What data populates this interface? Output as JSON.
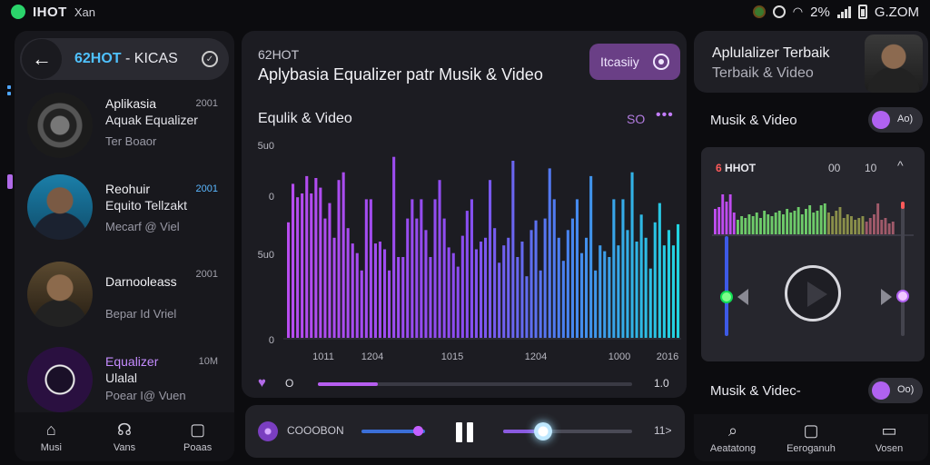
{
  "statusbar": {
    "app": "IHOT",
    "app_small": "Xan",
    "battery_pct": "2%",
    "time": "G.ZOM"
  },
  "left": {
    "header_accent": "62HOT",
    "header_title": " - KICAS",
    "items": [
      {
        "t1": "Aplikasia",
        "t2": "Aquak Equalizer",
        "t3": "Ter Boaor",
        "num": "2001"
      },
      {
        "t1": "Reohuir",
        "t2": "Equito Tellzakt",
        "t3": "Mecarf @ Viel",
        "num": "2001"
      },
      {
        "t1": "Darnooleass",
        "t2": "",
        "t3": "Bepar Id Vriel",
        "num": "2001"
      },
      {
        "t1": "Equalizer",
        "t2": "Ulalal",
        "t3": "Poear I@ Vuen",
        "num": "10M"
      }
    ],
    "nav": [
      {
        "icon": "⌂",
        "label": "Musi"
      },
      {
        "icon": "☊",
        "label": "Vans"
      },
      {
        "icon": "▢",
        "label": "Poaas"
      }
    ]
  },
  "center": {
    "small": "62HOT",
    "title": "Aplybasia Equalizer patr Musik & Video",
    "button_label": "Itcasiiy",
    "sub": "Equlik & Video",
    "count": "SO",
    "more": "•••",
    "progress_left": "O",
    "progress_right": "1.0",
    "progress": 0.19
  },
  "chart_data": {
    "type": "bar",
    "y_tick_labels": [
      "5u0",
      "0",
      "5u0",
      "0"
    ],
    "x_tick_labels": [
      "1011",
      "1204",
      "1015",
      "1204",
      "1000",
      "2016"
    ],
    "colors": [
      "#b84cf0",
      "#8a4cf0",
      "#4a7ff0",
      "#21d6df"
    ],
    "values": [
      60,
      80,
      73,
      75,
      84,
      75,
      83,
      78,
      62,
      70,
      52,
      82,
      86,
      57,
      49,
      44,
      35,
      72,
      72,
      49,
      50,
      46,
      35,
      94,
      42,
      42,
      62,
      72,
      62,
      72,
      56,
      42,
      72,
      82,
      62,
      47,
      44,
      37,
      53,
      66,
      72,
      46,
      50,
      52,
      82,
      57,
      39,
      48,
      52,
      92,
      42,
      50,
      32,
      56,
      61,
      35,
      62,
      88,
      72,
      52,
      40,
      56,
      62,
      72,
      44,
      52,
      84,
      35,
      48,
      45,
      42,
      72,
      48,
      72,
      56,
      86,
      50,
      64,
      52,
      36,
      60,
      70,
      48,
      56,
      48,
      59
    ]
  },
  "player": {
    "label": "COOOBON",
    "time": "11>",
    "volume": 0.85,
    "position": 0.31
  },
  "right": {
    "top_t1": "Aplulalizer Terbaik",
    "top_t2": "Terbaik & Video",
    "row1_label": "Musik & Video",
    "row1_toggle": "Ao)",
    "eq_title_red": "6",
    "eq_title": " HHOT",
    "eq_a": "00",
    "eq_b": "10",
    "eq_chevron": "^",
    "eq_bars": [
      28,
      30,
      44,
      36,
      44,
      24,
      16,
      20,
      18,
      22,
      20,
      24,
      18,
      26,
      22,
      20,
      24,
      26,
      22,
      28,
      24,
      26,
      30,
      22,
      28,
      32,
      24,
      26,
      32,
      34,
      24,
      20,
      26,
      30,
      18,
      22,
      20,
      16,
      18,
      20,
      14,
      18,
      22,
      34,
      16,
      18,
      12,
      14
    ],
    "eq_bar_colors": [
      "#c04cf0",
      "#6ecb6a",
      "#8a8f4a",
      "#a05a6a"
    ],
    "row2_label": "Musik & Videc-",
    "row2_toggle": "Oo)",
    "nav": [
      {
        "icon": "⌕",
        "label": "Aeatatong"
      },
      {
        "icon": "▢",
        "label": "Eeroganuh"
      },
      {
        "icon": "▭",
        "label": "Vosen"
      }
    ]
  }
}
